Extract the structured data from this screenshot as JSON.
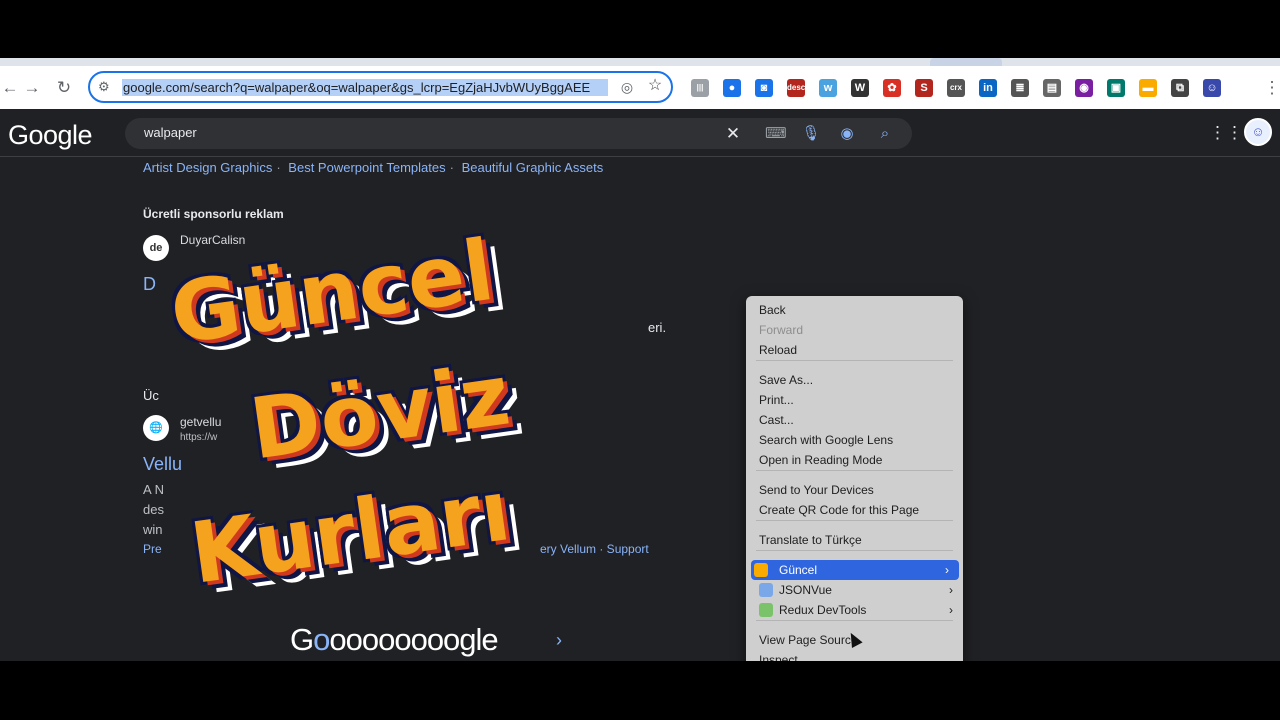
{
  "browser": {
    "url": "google.com/search?q=walpaper&oq=walpaper&gs_lcrp=EgZjaHJvbWUyBggAEE",
    "nav": {
      "back_icon": "arrow-left-icon",
      "forward_icon": "arrow-right-icon",
      "reload_icon": "reload-icon"
    },
    "extensions": [
      {
        "name": "barcode-ext-icon",
        "label": "|||",
        "color": "#9aa0a6"
      },
      {
        "name": "blue-circle-ext-icon",
        "label": "●",
        "color": "#1a73e8"
      },
      {
        "name": "screenshot-ext-icon",
        "label": "◙",
        "color": "#1a73e8"
      },
      {
        "name": "desc-ext-icon",
        "label": "desc",
        "color": "#b3261e"
      },
      {
        "name": "w-ext-icon",
        "label": "w",
        "color": "#4aa3df"
      },
      {
        "name": "wordpress-ext-icon",
        "label": "W",
        "color": "#333"
      },
      {
        "name": "color-wheel-ext-icon",
        "label": "✿",
        "color": "#d93025"
      },
      {
        "name": "s-ext-icon",
        "label": "S",
        "color": "#b3261e"
      },
      {
        "name": "crx-ext-icon",
        "label": "crx",
        "color": "#555"
      },
      {
        "name": "linkedin-ext-icon",
        "label": "in",
        "color": "#0a66c2"
      },
      {
        "name": "reader-ext-icon",
        "label": "≣",
        "color": "#555"
      },
      {
        "name": "doc-ext-icon",
        "label": "▤",
        "color": "#666"
      },
      {
        "name": "purple-ext-icon",
        "label": "◉",
        "color": "#7b1fa2"
      },
      {
        "name": "teal-ext-icon",
        "label": "▣",
        "color": "#00796b"
      },
      {
        "name": "yellow-ext-icon",
        "label": "▬",
        "color": "#f9ab00"
      },
      {
        "name": "puzzle-ext-icon",
        "label": "⧉",
        "color": "#444"
      },
      {
        "name": "profile-ext-icon",
        "label": "☺",
        "color": "#3949ab"
      }
    ]
  },
  "google": {
    "logo": "Google",
    "query": "walpaper",
    "related": [
      "Artist Design Graphics",
      "Best Powerpoint Templates",
      "Beautiful Graphic Assets"
    ],
    "ad_label": "Ücretli sponsorlu reklam",
    "result1_site": "DuyarCalisn",
    "result1_icon": "de",
    "result1_title_frag": "D",
    "result1_snippet_frag": "eri.",
    "label_frag": "Üc",
    "result2_site": "getvellu",
    "result2_url": "https://w",
    "result2_title_frag": "Vellu",
    "result2_snip1": "A N",
    "result2_snip2": "des",
    "result2_snip3": "win",
    "result2_link_frag": "Pre",
    "result2_links": "ery Vellum · Support",
    "paging_g": "G",
    "paging_o1": "o",
    "paging_rest": "oooooooogle"
  },
  "context_menu": {
    "items": [
      {
        "label": "Back",
        "disabled": false
      },
      {
        "label": "Forward",
        "disabled": true
      },
      {
        "label": "Reload",
        "disabled": false
      },
      {
        "label": "Save As...",
        "disabled": false
      },
      {
        "label": "Print...",
        "disabled": false
      },
      {
        "label": "Cast...",
        "disabled": false
      },
      {
        "label": "Search with Google Lens",
        "disabled": false
      },
      {
        "label": "Open in Reading Mode",
        "disabled": false
      },
      {
        "label": "Send to Your Devices",
        "disabled": false
      },
      {
        "label": "Create QR Code for this Page",
        "disabled": false
      },
      {
        "label": "Translate to Türkçe",
        "disabled": false
      },
      {
        "label": "Güncel",
        "disabled": false
      },
      {
        "label": "JSONVue",
        "disabled": false
      },
      {
        "label": "Redux DevTools",
        "disabled": false
      },
      {
        "label": "View Page Source",
        "disabled": false
      },
      {
        "label": "Inspect",
        "disabled": false
      }
    ],
    "highlighted": "Güncel"
  },
  "overlay": {
    "line1": "Güncel",
    "line2": "Döviz",
    "line3": "Kurları",
    "colors": {
      "fill": "#f5a21e",
      "shadow": "#d1391f",
      "outline": "#0f1544",
      "halo": "#ffffff"
    }
  }
}
